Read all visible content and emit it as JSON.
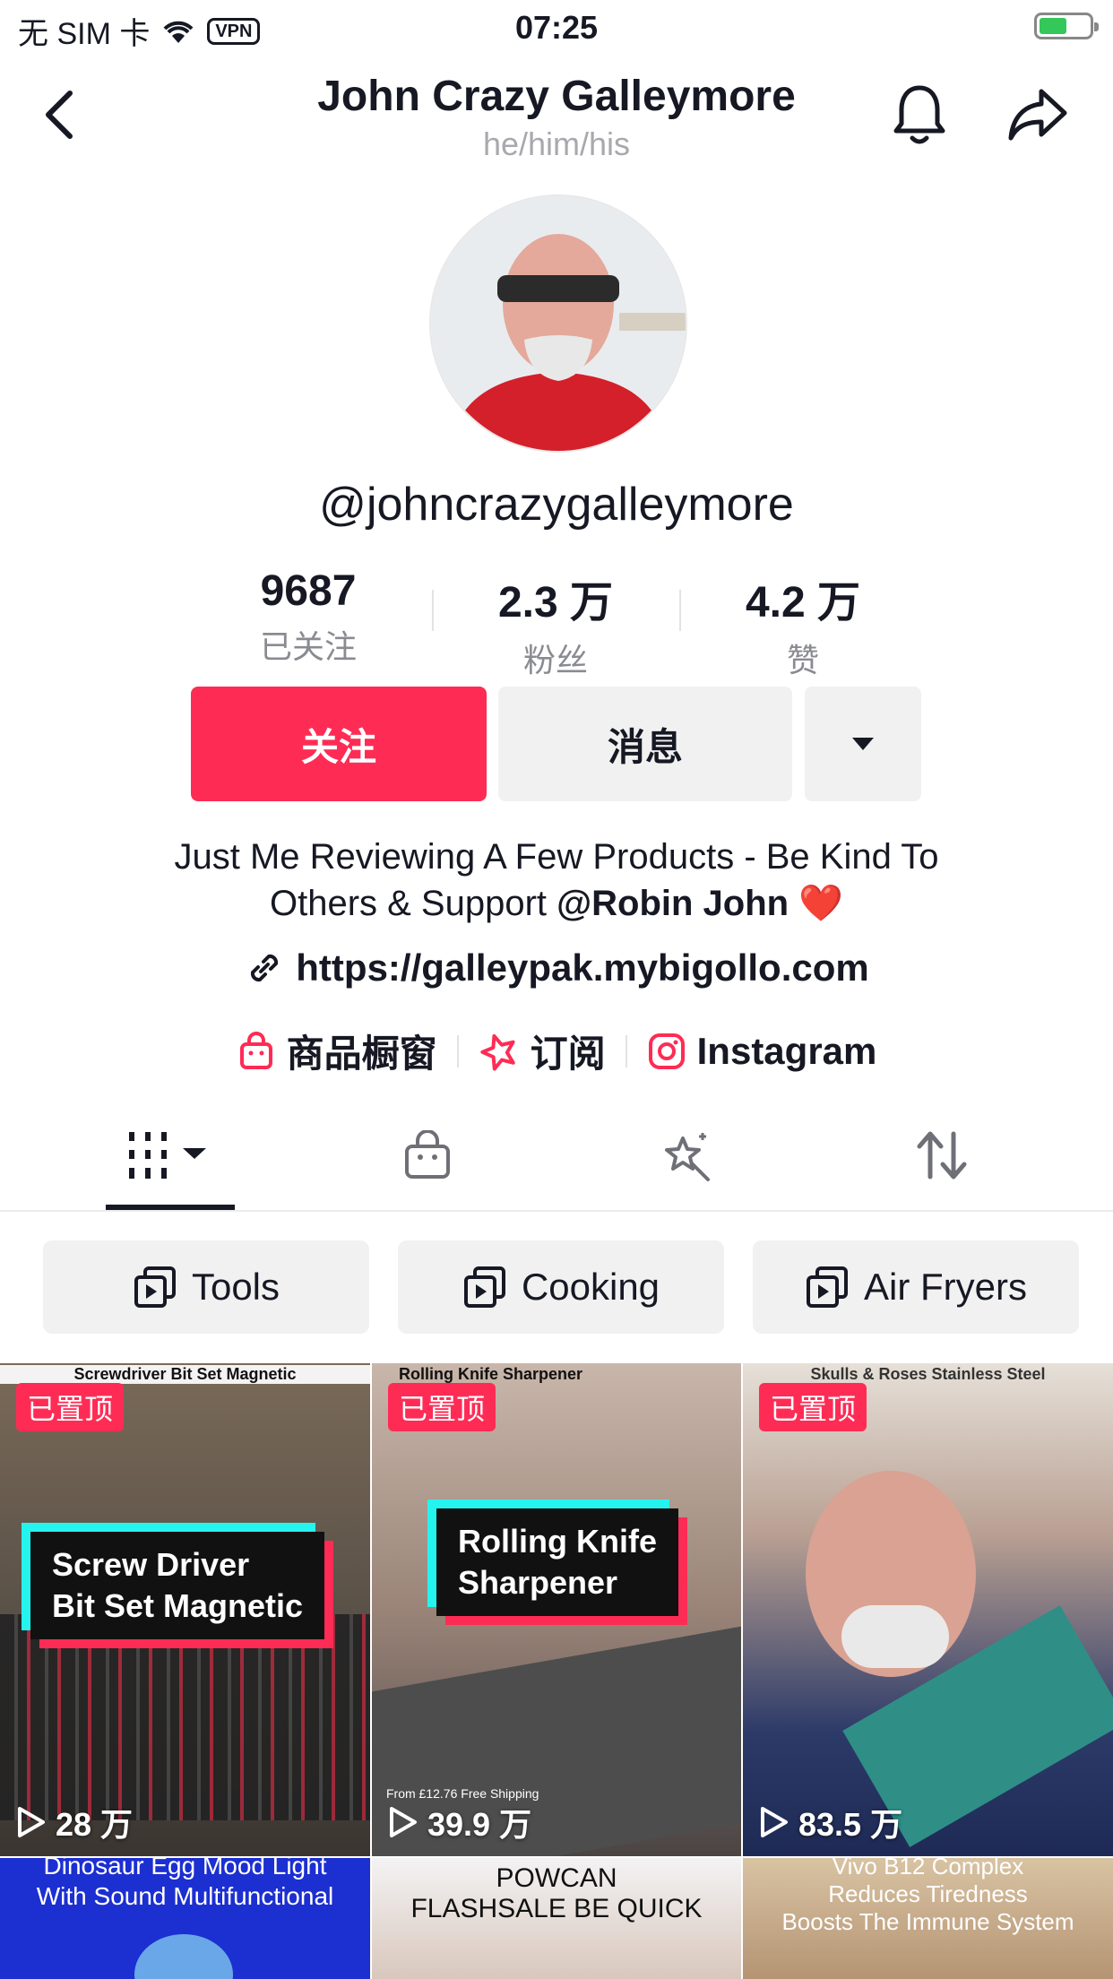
{
  "status_bar": {
    "carrier": "无 SIM 卡",
    "vpn": "VPN",
    "time": "07:25"
  },
  "header": {
    "title": "John Crazy Galleymore",
    "pronouns": "he/him/his"
  },
  "profile": {
    "handle": "@johncrazygalleymore",
    "stats": [
      {
        "value": "9687",
        "label": "已关注"
      },
      {
        "value": "2.3 万",
        "label": "粉丝"
      },
      {
        "value": "4.2 万",
        "label": "赞"
      }
    ],
    "follow_label": "关注",
    "message_label": "消息",
    "bio_line1": "Just Me Reviewing A Few Products - Be Kind To",
    "bio_line2_prefix": "Others & Support ",
    "bio_mention": "@Robin John",
    "bio_emoji": "❤️",
    "link": "https://galleypak.mybigollo.com",
    "shortcuts": {
      "shop": "商品橱窗",
      "subscribe": "订阅",
      "instagram": "Instagram"
    }
  },
  "playlists": [
    "Tools",
    "Cooking",
    "Air Fryers"
  ],
  "videos": [
    {
      "pinned": "已置顶",
      "top_text": "Screwdriver Bit Set Magnetic",
      "caption_line1": "Screw Driver",
      "caption_line2": "Bit Set Magnetic",
      "views": "28 万"
    },
    {
      "pinned": "已置顶",
      "top_text": "Rolling Knife Sharpener",
      "caption_line1": "Rolling Knife",
      "caption_line2": "Sharpener",
      "overlay": "From £12.76 Free Shipping",
      "views": "39.9 万"
    },
    {
      "pinned": "已置顶",
      "top_text": "Skulls & Roses Stainless Steel",
      "views": "83.5 万"
    },
    {
      "text_line1": "Dinosaur Egg Mood Light",
      "text_line2": "With Sound Multifunctional"
    },
    {
      "text_line1": "POWCAN",
      "text_line2": "FLASHSALE BE QUICK"
    },
    {
      "text_line1": "Vivo B12 Complex",
      "text_line2": "Reduces Tiredness",
      "text_line3": "Boosts The Immune System"
    }
  ],
  "colors": {
    "accent": "#fe2c55",
    "text": "#161823",
    "muted": "#8a8b91",
    "chip_bg": "#f1f1f2"
  }
}
